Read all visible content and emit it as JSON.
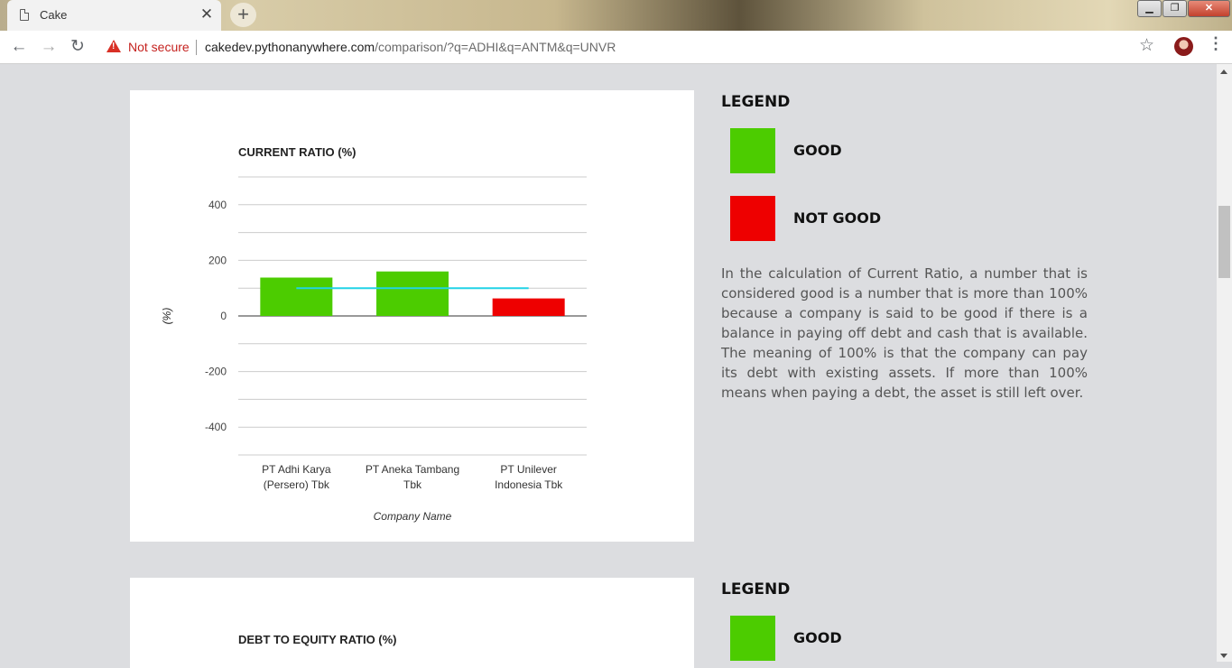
{
  "browser": {
    "tab_title": "Cake",
    "new_tab_label": "+",
    "security_label": "Not secure",
    "url_host": "cakedev.pythonanywhere.com",
    "url_path": "/comparison/?q=ADHI&q=ANTM&q=UNVR"
  },
  "sections": [
    {
      "legend_heading": "LEGEND",
      "good_label": "GOOD",
      "not_good_label": "NOT GOOD",
      "description": "In the calculation of Current Ratio, a number that is considered good is a number that is more than 100% because a company is said to be good if there is a balance in paying off debt and cash that is available. The meaning of 100% is that the company can pay its debt with existing assets. If more than 100% means when paying a debt, the asset is still left over."
    },
    {
      "legend_heading": "LEGEND",
      "good_label": "GOOD"
    }
  ],
  "colors": {
    "good": "#4ccc00",
    "not_good": "#ee0000",
    "threshold_line": "#22d3e6"
  },
  "chart_data": [
    {
      "type": "bar",
      "title": "CURRENT RATIO (%)",
      "xlabel": "Company Name",
      "ylabel": "(%)",
      "categories": [
        "PT Adhi Karya (Persero) Tbk",
        "PT Aneka Tambang Tbk",
        "PT Unilever Indonesia Tbk"
      ],
      "values": [
        138,
        160,
        63
      ],
      "bar_colors": [
        "#4ccc00",
        "#4ccc00",
        "#ee0000"
      ],
      "threshold": 100,
      "yticks": [
        400,
        200,
        0,
        -200,
        -400
      ],
      "ylim": [
        -500,
        500
      ],
      "grid": true
    },
    {
      "type": "bar",
      "title": "DEBT TO EQUITY RATIO (%)"
    }
  ]
}
